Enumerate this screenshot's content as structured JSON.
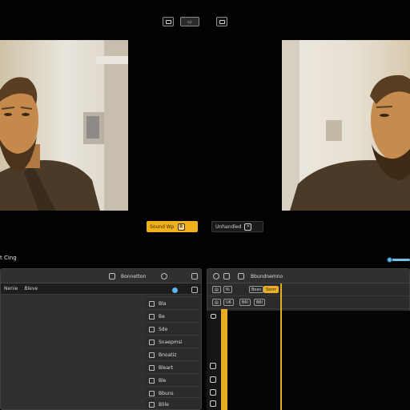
{
  "toolbar": {
    "left_icon": "square-icon",
    "center_label": "▭",
    "right_icon": "square-icon"
  },
  "preview": {
    "left_button_label": "Sound Wp",
    "left_button_icon": "copy-icon",
    "right_button_label": "Unhandled",
    "right_button_icon": "close-icon"
  },
  "section": {
    "label": "t Cing"
  },
  "left_panel": {
    "header_text": "Bonnetton",
    "tabs": [
      "Nenie",
      "Bleve"
    ],
    "side_items": [
      "Bla",
      "Be",
      "Sde",
      "Snaepmsi",
      "Bnoatiz",
      "Bleart",
      "Ble",
      "Bbuns",
      "Blile"
    ]
  },
  "right_panel": {
    "header_text": "Bbundnemno",
    "row1_labels": [
      "N:",
      "Boxn",
      "Ssnrr"
    ],
    "row2_labels": [
      "U6",
      "B6l"
    ]
  },
  "colors": {
    "accent_yellow": "#f0b11d",
    "accent_blue": "#5bb6e8",
    "panel_bg": "#2b2b2d",
    "app_bg": "#020202"
  }
}
